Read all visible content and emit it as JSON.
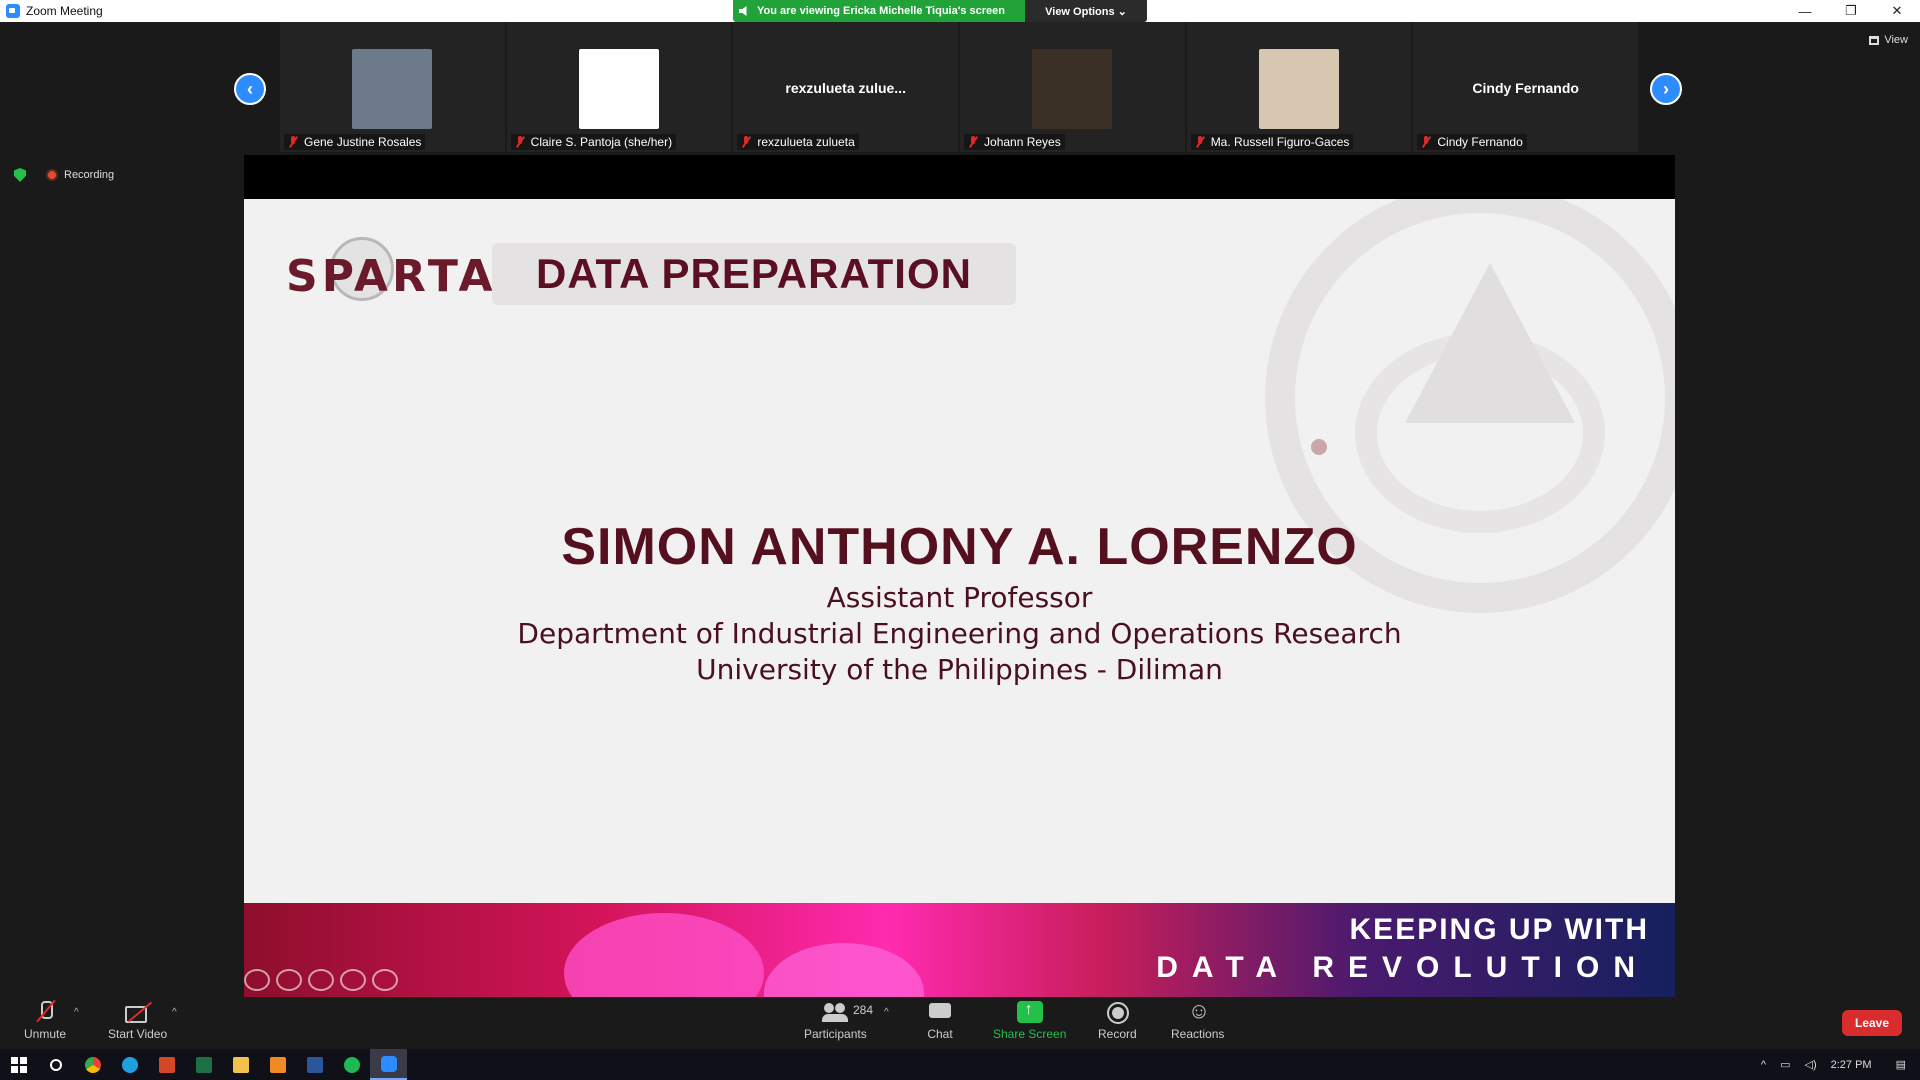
{
  "window": {
    "title": "Zoom Meeting",
    "controls": [
      "—",
      "❐",
      "✕"
    ]
  },
  "viewing_banner": {
    "text": "You are viewing Ericka Michelle Tiquia's screen",
    "options_label": "View Options ⌄"
  },
  "view_button": "View",
  "gallery": [
    {
      "name": "Gene Justine Rosales",
      "tile_text": "",
      "has_video": true,
      "color": "#6c7a8a"
    },
    {
      "name": "Claire S. Pantoja (she/her)",
      "tile_text": "",
      "has_video": true,
      "color": "#ffffff"
    },
    {
      "name": "rexzulueta zulueta",
      "tile_text": "rexzulueta  zulue...",
      "has_video": false,
      "color": ""
    },
    {
      "name": "Johann Reyes",
      "tile_text": "",
      "has_video": true,
      "color": "#3b3026"
    },
    {
      "name": "Ma. Russell Figuro-Gaces",
      "tile_text": "",
      "has_video": true,
      "color": "#d7c7b0"
    },
    {
      "name": "Cindy Fernando",
      "tile_text": "Cindy Fernando",
      "has_video": false,
      "color": ""
    }
  ],
  "status": {
    "recording": "Recording"
  },
  "slide": {
    "logo": "SPARTA",
    "section_title": "DATA PREPARATION",
    "speaker_name": "SIMON ANTHONY A. LORENZO",
    "position": "Assistant Professor",
    "department": "Department of Industrial Engineering and Operations Research",
    "university": "University of the Philippines - Diliman",
    "banner_line1": "KEEPING UP WITH",
    "banner_line2": "DATA REVOLUTION"
  },
  "toolbar": {
    "unmute": "Unmute",
    "start_video": "Start Video",
    "participants": "Participants",
    "participants_count": "284",
    "chat": "Chat",
    "share_screen": "Share Screen",
    "record": "Record",
    "reactions": "Reactions",
    "leave": "Leave"
  },
  "taskbar": {
    "apps": [
      "search",
      "chrome",
      "edge",
      "powerpoint",
      "excel",
      "file-explorer",
      "sublime",
      "word",
      "spotify",
      "zoom"
    ],
    "clock": "2:27 PM"
  }
}
